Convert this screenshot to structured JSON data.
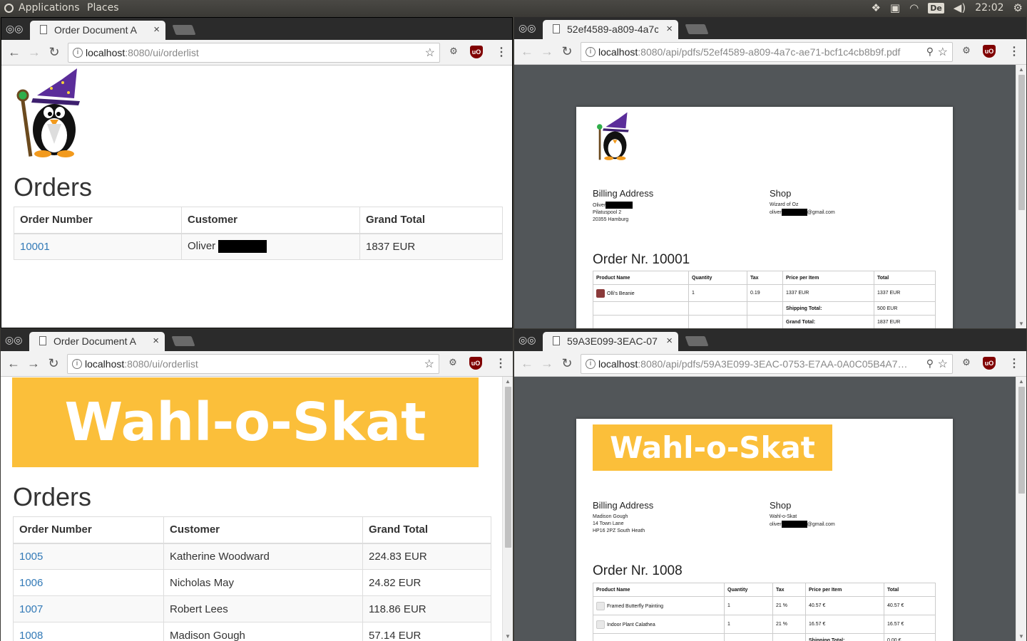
{
  "system_bar": {
    "applications": "Applications",
    "places": "Places",
    "keyboard_layout": "De",
    "clock": "22:02",
    "tray_icons": [
      "dropbox-icon",
      "clipboard-icon",
      "wifi-icon",
      "keyboard-icon",
      "volume-icon",
      "power-icon"
    ]
  },
  "windows": [
    {
      "tab_title": "Order Document A",
      "url_host": "localhost",
      "url_path": ":8080/ui/orderlist",
      "heading": "Orders",
      "columns": [
        "Order Number",
        "Customer",
        "Grand Total"
      ],
      "rows": [
        {
          "number": "10001",
          "customer": "Oliver",
          "total": "1837 EUR"
        }
      ]
    },
    {
      "tab_title": "52ef4589-a809-4a7c",
      "url_host": "localhost",
      "url_path": ":8080/api/pdfs/52ef4589-a809-4a7c-ae71-bcf1c4cb8b9f.pdf",
      "billing_heading": "Billing Address",
      "billing_lines": [
        "Oliver",
        "Pilatuspool 2",
        "20355 Hamburg"
      ],
      "shop_heading": "Shop",
      "shop_lines": [
        "Wizard of Oz",
        "oliver",
        "@gmail.com"
      ],
      "order_title": "Order Nr. 10001",
      "table_headers": [
        "Product Name",
        "Quantity",
        "Tax",
        "Price per Item",
        "Total"
      ],
      "items": [
        {
          "name": "Olli's Beanie",
          "qty": "1",
          "tax": "0.19",
          "price": "1337 EUR",
          "total": "1337 EUR"
        }
      ],
      "shipping_label": "Shipping Total:",
      "shipping_value": "500 EUR",
      "grand_label": "Grand Total:",
      "grand_value": "1837 EUR"
    },
    {
      "tab_title": "Order Document A",
      "url_host": "localhost",
      "url_path": ":8080/ui/orderlist",
      "banner": "Wahl-o-Skat",
      "heading": "Orders",
      "columns": [
        "Order Number",
        "Customer",
        "Grand Total"
      ],
      "rows": [
        {
          "number": "1005",
          "customer": "Katherine Woodward",
          "total": "224.83 EUR"
        },
        {
          "number": "1006",
          "customer": "Nicholas May",
          "total": "24.82 EUR"
        },
        {
          "number": "1007",
          "customer": "Robert Lees",
          "total": "118.86 EUR"
        },
        {
          "number": "1008",
          "customer": "Madison Gough",
          "total": "57.14 EUR"
        }
      ]
    },
    {
      "tab_title": "59A3E099-3EAC-07",
      "url_host": "localhost",
      "url_path": ":8080/api/pdfs/59A3E099-3EAC-0753-E7AA-0A0C05B4A7…",
      "banner": "Wahl-o-Skat",
      "billing_heading": "Billing Address",
      "billing_lines": [
        "Madison Gough",
        "14 Town Lane",
        "HP16 2PZ South Heath"
      ],
      "shop_heading": "Shop",
      "shop_lines": [
        "Wahl-o-Skat",
        "oliver",
        "@gmail.com"
      ],
      "order_title": "Order Nr. 1008",
      "table_headers": [
        "Product Name",
        "Quantity",
        "Tax",
        "Price per Item",
        "Total"
      ],
      "items": [
        {
          "name": "Framed Butterfly Painting",
          "qty": "1",
          "tax": "21 %",
          "price": "40.57 €",
          "total": "40.57 €"
        },
        {
          "name": "Indoor Plant Calathea",
          "qty": "1",
          "tax": "21 %",
          "price": "16.57 €",
          "total": "16.57 €"
        }
      ],
      "shipping_label": "Shipping Total:",
      "shipping_value": "0.00 €"
    }
  ],
  "colors": {
    "link": "#337ab7",
    "banner": "#fbbf3a",
    "pdf_viewer_bg": "#525659",
    "chrome_tabstrip": "#2b2b2b"
  }
}
